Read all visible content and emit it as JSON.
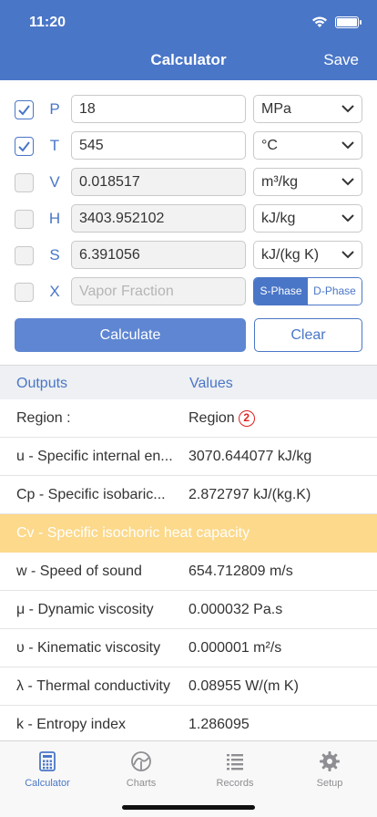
{
  "status": {
    "time": "11:20"
  },
  "nav": {
    "title": "Calculator",
    "save_label": "Save"
  },
  "inputs": [
    {
      "label": "P",
      "checked": true,
      "value": "18",
      "unit": "MPa",
      "disabled": false
    },
    {
      "label": "T",
      "checked": true,
      "value": "545",
      "unit": "°C",
      "disabled": false
    },
    {
      "label": "V",
      "checked": false,
      "value": "0.018517",
      "unit": "m³/kg",
      "disabled": true
    },
    {
      "label": "H",
      "checked": false,
      "value": "3403.952102",
      "unit": "kJ/kg",
      "disabled": true
    },
    {
      "label": "S",
      "checked": false,
      "value": "6.391056",
      "unit": "kJ/(kg K)",
      "disabled": true
    },
    {
      "label": "X",
      "checked": false,
      "placeholder": "Vapor Fraction",
      "disabled": true
    }
  ],
  "phase": {
    "s_phase": "S-Phase",
    "d_phase": "D-Phase",
    "selected": "S-Phase"
  },
  "buttons": {
    "calculate": "Calculate",
    "clear": "Clear"
  },
  "outputs": {
    "header_outputs": "Outputs",
    "header_values": "Values",
    "region_label": "Region :",
    "region_value": "Region",
    "region_number": "2",
    "rows": [
      {
        "name": "u - Specific internal en...",
        "value": "3070.644077 kJ/kg"
      },
      {
        "name": "Cp - Specific isobaric...",
        "value": "2.872797 kJ/(kg.K)"
      },
      {
        "name": "Cv - Specific isochoric heat capacity",
        "value": "",
        "highlight": true
      },
      {
        "name": "w - Speed of sound",
        "value": "654.712809 m/s"
      },
      {
        "name": "μ - Dynamic viscosity",
        "value": "0.000032 Pa.s"
      },
      {
        "name": "υ - Kinematic viscosity",
        "value": "0.000001 m²/s"
      },
      {
        "name": "λ - Thermal conductivity",
        "value": "0.08955 W/(m K)"
      },
      {
        "name": "k - Entropy index",
        "value": "1.286095"
      }
    ]
  },
  "tabs": [
    {
      "label": "Calculator",
      "icon": "calculator-icon",
      "active": true
    },
    {
      "label": "Charts",
      "icon": "chart-gauge-icon",
      "active": false
    },
    {
      "label": "Records",
      "icon": "list-icon",
      "active": false
    },
    {
      "label": "Setup",
      "icon": "gear-icon",
      "active": false
    }
  ],
  "colors": {
    "accent": "#4a76c7",
    "highlight": "#fcd98b",
    "region_marker": "#e02020"
  }
}
